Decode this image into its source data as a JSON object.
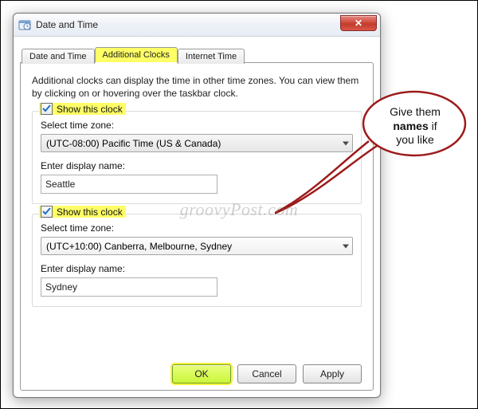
{
  "window": {
    "title": "Date and Time",
    "close_symbol": "✕"
  },
  "tabs": {
    "date_time": "Date and Time",
    "additional_clocks": "Additional Clocks",
    "internet_time": "Internet Time"
  },
  "panel": {
    "description": "Additional clocks can display the time in other time zones. You can view them by clicking on or hovering over the taskbar clock."
  },
  "clock1": {
    "show_label": "Show this clock",
    "checked": true,
    "tz_label": "Select time zone:",
    "tz_value": "(UTC-08:00) Pacific Time (US & Canada)",
    "name_label": "Enter display name:",
    "name_value": "Seattle"
  },
  "clock2": {
    "show_label": "Show this clock",
    "checked": true,
    "tz_label": "Select time zone:",
    "tz_value": "(UTC+10:00) Canberra, Melbourne, Sydney",
    "name_label": "Enter display name:",
    "name_value": "Sydney"
  },
  "buttons": {
    "ok": "OK",
    "cancel": "Cancel",
    "apply": "Apply"
  },
  "callout": {
    "line1": "Give them",
    "bold": "names",
    "line2_rest": " if",
    "line3": "you like"
  },
  "watermark": "groovyPost.com",
  "highlights": {
    "tab_additional": true,
    "clock1_show": true,
    "clock2_show": true,
    "ok_primary": true
  }
}
